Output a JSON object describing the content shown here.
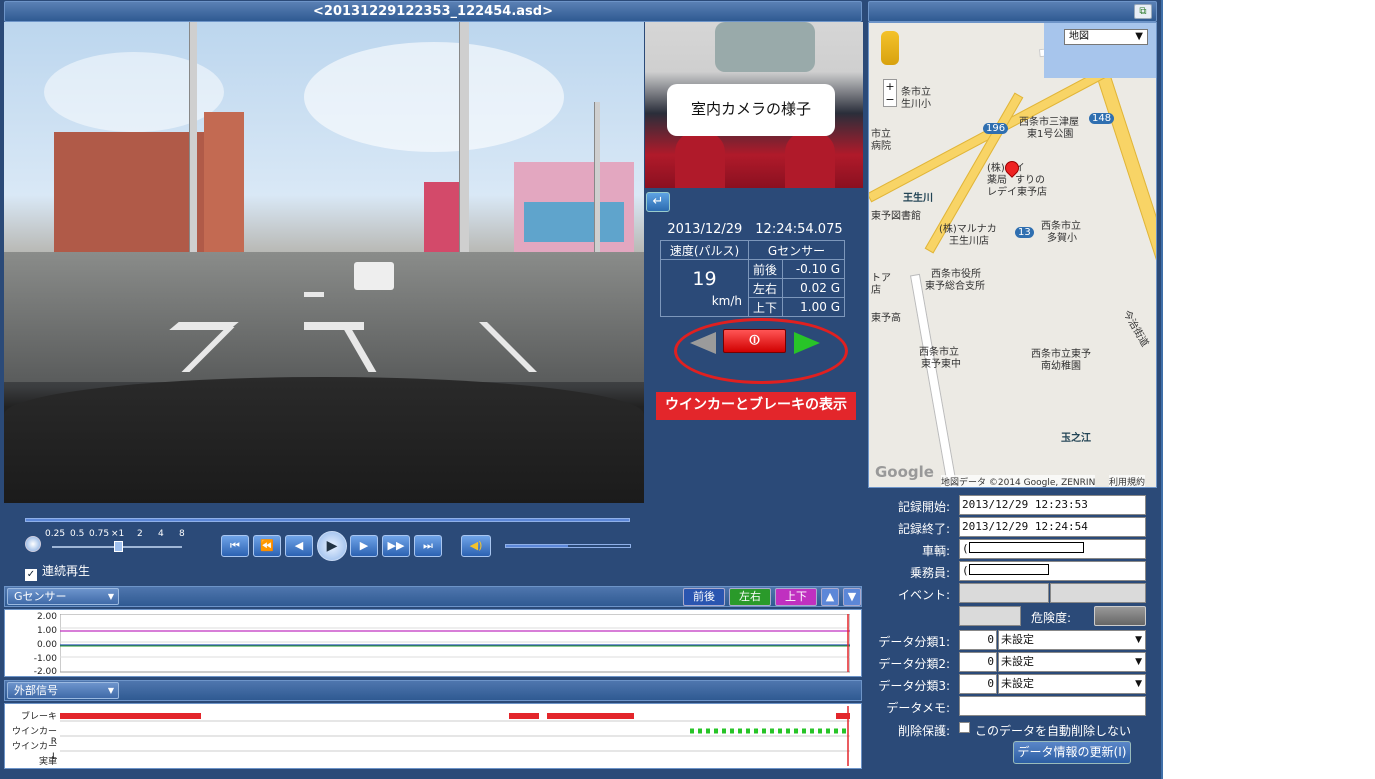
{
  "title": "<20131229122353_122454.asd>",
  "incam_caption": "室内カメラの様子",
  "datetime": "2013/12/29　12:24:54.075",
  "speed": {
    "header": "速度(パルス)",
    "value": "19",
    "unit": "km/h"
  },
  "gsensor": {
    "header": "Gセンサー",
    "rows": [
      {
        "label": "前後",
        "value": "-0.10 G"
      },
      {
        "label": "左右",
        "value": "0.02 G"
      },
      {
        "label": "上下",
        "value": "1.00 G"
      }
    ]
  },
  "indicator_label": "ウインカーとブレーキの表示",
  "map": {
    "type_select": "地図",
    "copyright": "地図データ ©2014 Google, ZENRIN",
    "terms": "利用規約",
    "google": "Google",
    "labels": [
      "条市立",
      "生川小",
      "市立",
      "病院",
      "西条市三津屋",
      "東1号公園",
      "(株)デイ",
      "薬局",
      "すりの",
      "レデイ東予店",
      "王生川",
      "東予図書館",
      "(株)マルナカ",
      "王生川店",
      "西条市立",
      "多賀小",
      "西条市役所",
      "東予総合支所",
      "トア",
      "店",
      "東予高",
      "西条市立",
      "東予東中",
      "西条市立東予",
      "南幼稚園",
      "玉之江",
      "今治街道"
    ],
    "route_numbers": [
      "196",
      "148",
      "13"
    ]
  },
  "form": {
    "start_label": "記録開始:",
    "start": "2013/12/29 12:23:53",
    "end_label": "記録終了:",
    "end": "2013/12/29 12:24:54",
    "vehicle_label": "車輌:",
    "vehicle": "(",
    "crew_label": "乗務員:",
    "crew": "(",
    "event_label": "イベント:",
    "risk_label": "危険度:",
    "cat1_label": "データ分類1:",
    "cat1_num": "0",
    "cat1": "未設定",
    "cat2_label": "データ分類2:",
    "cat2_num": "0",
    "cat2": "未設定",
    "cat3_label": "データ分類3:",
    "cat3_num": "0",
    "cat3": "未設定",
    "memo_label": "データメモ:",
    "protect_label": "削除保護:",
    "protect_text": "このデータを自動削除しない",
    "update_button": "データ情報の更新(I)"
  },
  "playback": {
    "speed_ticks": [
      "0.25",
      "0.5",
      "0.75",
      "×1",
      "2",
      "4",
      "8"
    ],
    "continuous": "連続再生",
    "buttons": [
      "⏮",
      "⏪",
      "◀",
      "▶",
      "▶▶",
      "⏭"
    ],
    "volume": 0.5
  },
  "gpanel": {
    "dropdown": "Gセンサー",
    "buttons": [
      "前後",
      "左右",
      "上下"
    ],
    "yticks": [
      "2.00",
      "1.00",
      "0.00",
      "-1.00",
      "-2.00"
    ]
  },
  "signal": {
    "dropdown": "外部信号",
    "rows": [
      "ブレーキ",
      "ウインカーR",
      "ウインカーL",
      "実車"
    ]
  },
  "colors": {
    "brake": "#e3262b",
    "blinker_right": "#28c428",
    "g_updown": "#c030c0",
    "g_leftright": "#2a9a2a",
    "g_frontback": "#2a55b0"
  }
}
